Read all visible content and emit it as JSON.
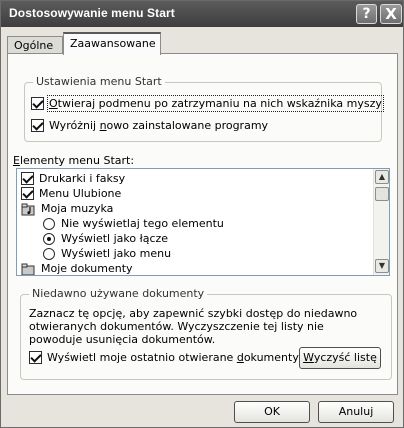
{
  "window": {
    "title": "Dostosowywanie menu Start"
  },
  "titlebar": {
    "help_glyph": "?",
    "close_glyph": "X"
  },
  "tabs": [
    {
      "label": "Ogólne"
    },
    {
      "label": "Zaawansowane"
    }
  ],
  "start_menu_settings": {
    "title": "Ustawienia menu Start",
    "open_submenus": {
      "mnemonic": "O",
      "rest": "twieraj podmenu po zatrzymaniu na nich wskaźnika myszy",
      "checked": true
    },
    "highlight_new": {
      "before": "Wyróżnij ",
      "mnemonic": "n",
      "rest": "owo zainstalowane programy",
      "checked": true
    }
  },
  "items_section": {
    "mnemonic": "E",
    "rest": "lementy menu Start:",
    "items": [
      {
        "label": "Drukarki i faksy",
        "kind": "checkbox",
        "checked": true
      },
      {
        "label": "Menu Ulubione",
        "kind": "checkbox",
        "checked": true
      },
      {
        "label": "Moja muzyka",
        "kind": "folder-icon"
      },
      {
        "label": "Nie wyświetlaj tego elementu",
        "kind": "radio",
        "selected": false
      },
      {
        "label": "Wyświetl jako łącze",
        "kind": "radio",
        "selected": true
      },
      {
        "label": "Wyświetl jako menu",
        "kind": "radio",
        "selected": false
      },
      {
        "label": "Moje dokumenty",
        "kind": "folder-icon"
      }
    ],
    "scroll_up": "▲",
    "scroll_down": "▼"
  },
  "recent_docs": {
    "title": "Niedawno używane dokumenty",
    "description": "Zaznacz tę opcję, aby zapewnić szybki dostęp do niedawno otwieranych dokumentów. Wyczyszczenie tej listy nie powoduje usunięcia dokumentów.",
    "show_recent": {
      "before": "Wyświetl moje ostatnio otwierane ",
      "mnemonic": "d",
      "rest": "okumenty",
      "checked": true
    },
    "clear_button": {
      "mnemonic": "W",
      "rest": "yczyść listę"
    }
  },
  "buttons": {
    "ok": "OK",
    "cancel": "Anuluj"
  }
}
